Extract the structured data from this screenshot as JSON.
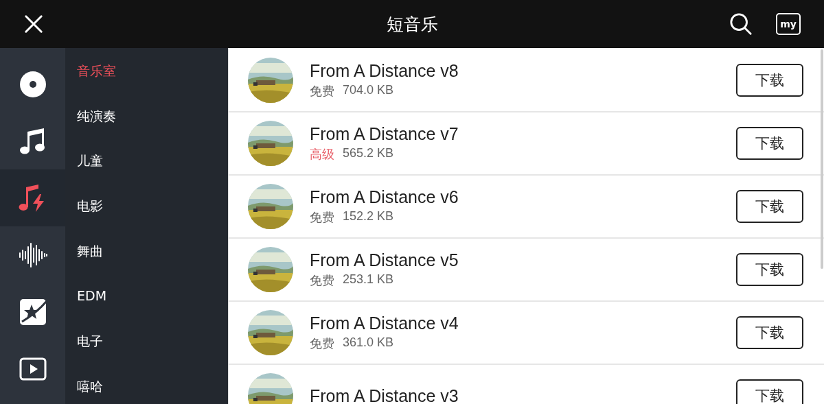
{
  "header": {
    "title": "短音乐",
    "my_label": "my"
  },
  "icon_rail": [
    {
      "kind": "disc",
      "selected": false
    },
    {
      "kind": "note",
      "selected": false
    },
    {
      "kind": "note-bolt",
      "selected": true
    },
    {
      "kind": "wave",
      "selected": false
    },
    {
      "kind": "star",
      "selected": false
    },
    {
      "kind": "play",
      "selected": false
    }
  ],
  "categories": [
    {
      "label": "音乐室",
      "selected": true
    },
    {
      "label": "纯演奏",
      "selected": false
    },
    {
      "label": "儿童",
      "selected": false
    },
    {
      "label": "电影",
      "selected": false
    },
    {
      "label": "舞曲",
      "selected": false
    },
    {
      "label": "EDM",
      "selected": false
    },
    {
      "label": "电子",
      "selected": false
    },
    {
      "label": "嘻哈",
      "selected": false
    }
  ],
  "tracks": [
    {
      "title": "From A Distance v8",
      "tier": "免费",
      "kind": "free",
      "size": "704.0 KB",
      "button": "下载"
    },
    {
      "title": "From A Distance v7",
      "tier": "高级",
      "kind": "premium",
      "size": "565.2 KB",
      "button": "下载"
    },
    {
      "title": "From A Distance v6",
      "tier": "免费",
      "kind": "free",
      "size": "152.2 KB",
      "button": "下载"
    },
    {
      "title": "From A Distance v5",
      "tier": "免费",
      "kind": "free",
      "size": "253.1 KB",
      "button": "下载"
    },
    {
      "title": "From A Distance v4",
      "tier": "免费",
      "kind": "free",
      "size": "361.0 KB",
      "button": "下载"
    },
    {
      "title": "From A Distance v3",
      "button": "下载"
    }
  ]
}
